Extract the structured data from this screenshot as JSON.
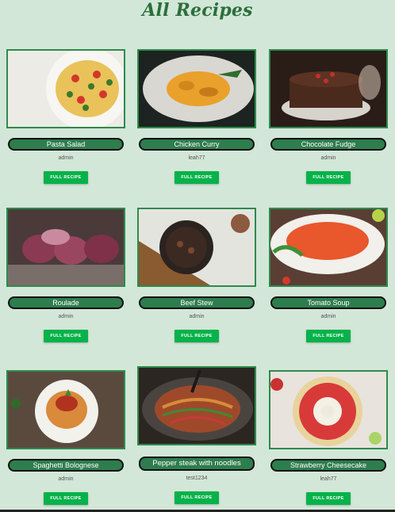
{
  "page": {
    "title": "All Recipes"
  },
  "recipes": [
    {
      "name": "Pasta Salad",
      "author": "admin",
      "button": "FULL RECIPE"
    },
    {
      "name": "Chicken Curry",
      "author": "leah77",
      "button": "FULL RECIPE"
    },
    {
      "name": "Chocolate Fudge",
      "author": "admin",
      "button": "FULL RECIPE"
    },
    {
      "name": "Roulade",
      "author": "admin",
      "button": "FULL RECIPE"
    },
    {
      "name": "Beef Stew",
      "author": "admin",
      "button": "FULL RECIPE"
    },
    {
      "name": "Tomato Soup",
      "author": "admin",
      "button": "FULL RECIPE"
    },
    {
      "name": "Spaghetti Bolognese",
      "author": "admin",
      "button": "FULL RECIPE"
    },
    {
      "name": "Pepper steak with noodles",
      "author": "test1234",
      "button": "FULL RECIPE"
    },
    {
      "name": "Strawberry Cheesecake",
      "author": "leah77",
      "button": "FULL RECIPE"
    }
  ],
  "colors": {
    "background": "#d2e7d8",
    "accent": "#2e7d4d",
    "button": "#06b24a",
    "title": "#2c6e3b"
  }
}
